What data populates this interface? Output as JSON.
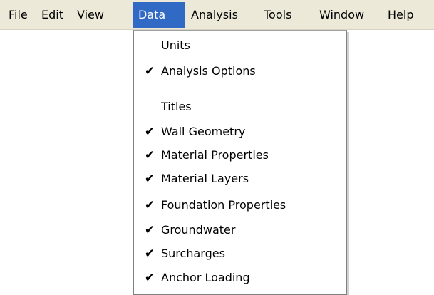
{
  "menubar": {
    "items": [
      {
        "label": "File",
        "active": false
      },
      {
        "label": "Edit",
        "active": false
      },
      {
        "label": "View",
        "active": false
      },
      {
        "label": "Data",
        "active": true
      },
      {
        "label": "Analysis",
        "active": false
      },
      {
        "label": "Tools",
        "active": false
      },
      {
        "label": "Window",
        "active": false
      },
      {
        "label": "Help",
        "active": false
      }
    ]
  },
  "data_menu": {
    "items": [
      {
        "label": "Units",
        "checked": false
      },
      {
        "label": "Analysis Options",
        "checked": true
      },
      {
        "label": "Titles",
        "checked": false
      },
      {
        "label": "Wall Geometry",
        "checked": true
      },
      {
        "label": "Material Properties",
        "checked": true
      },
      {
        "label": "Material Layers",
        "checked": true
      },
      {
        "label": "Foundation Properties",
        "checked": true
      },
      {
        "label": "Groundwater",
        "checked": true
      },
      {
        "label": "Surcharges",
        "checked": true
      },
      {
        "label": "Anchor Loading",
        "checked": true
      }
    ],
    "check_glyph": "✔"
  },
  "colors": {
    "menubar_background": "#ece9d8",
    "highlight": "#316ac5",
    "menu_background": "#ffffff"
  }
}
